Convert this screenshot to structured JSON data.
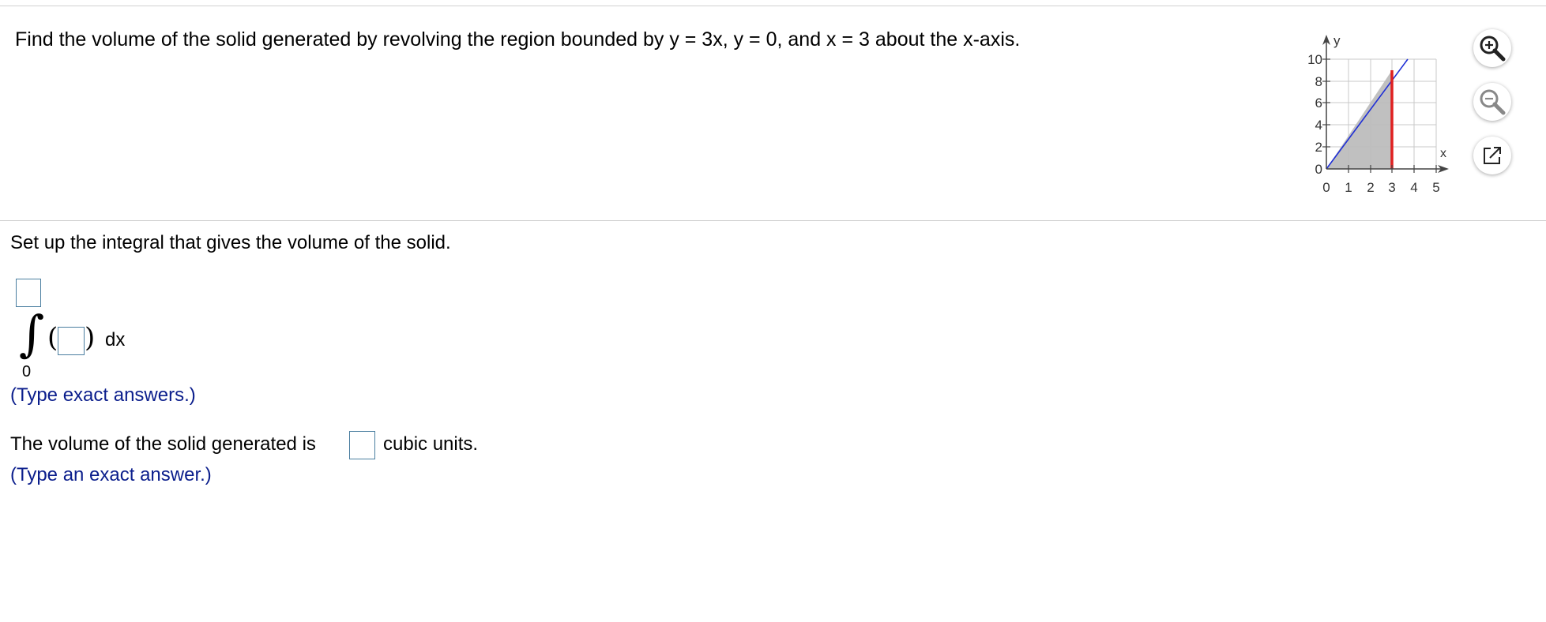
{
  "question": {
    "text": "Find the volume of the solid generated by revolving the region bounded by y = 3x, y = 0, and x = 3 about the x-axis."
  },
  "graph": {
    "x_axis_label": "x",
    "y_axis_label": "y",
    "x_ticks": [
      "0",
      "1",
      "2",
      "3",
      "4",
      "5"
    ],
    "y_ticks": [
      "0",
      "2",
      "4",
      "6",
      "8",
      "10"
    ],
    "curve": "y = 3x",
    "boundary": "x = 3",
    "curve_color": "#1f2fd6",
    "boundary_color": "#e02020",
    "region_color": "#c0c0c0"
  },
  "tools": {
    "zoom_in": "zoom-in-icon",
    "zoom_out": "zoom-out-icon",
    "popout": "popout-icon"
  },
  "step1": {
    "label": "Set up the integral that gives the volume of the solid.",
    "integral_lower_limit": "0",
    "upper_limit_value": "",
    "integrand_value": "",
    "differential": "dx",
    "hint": "(Type exact answers.)"
  },
  "step2": {
    "label": "The volume of the solid generated is",
    "answer_value": "",
    "units": "cubic units.",
    "hint": "(Type an exact answer.)"
  }
}
